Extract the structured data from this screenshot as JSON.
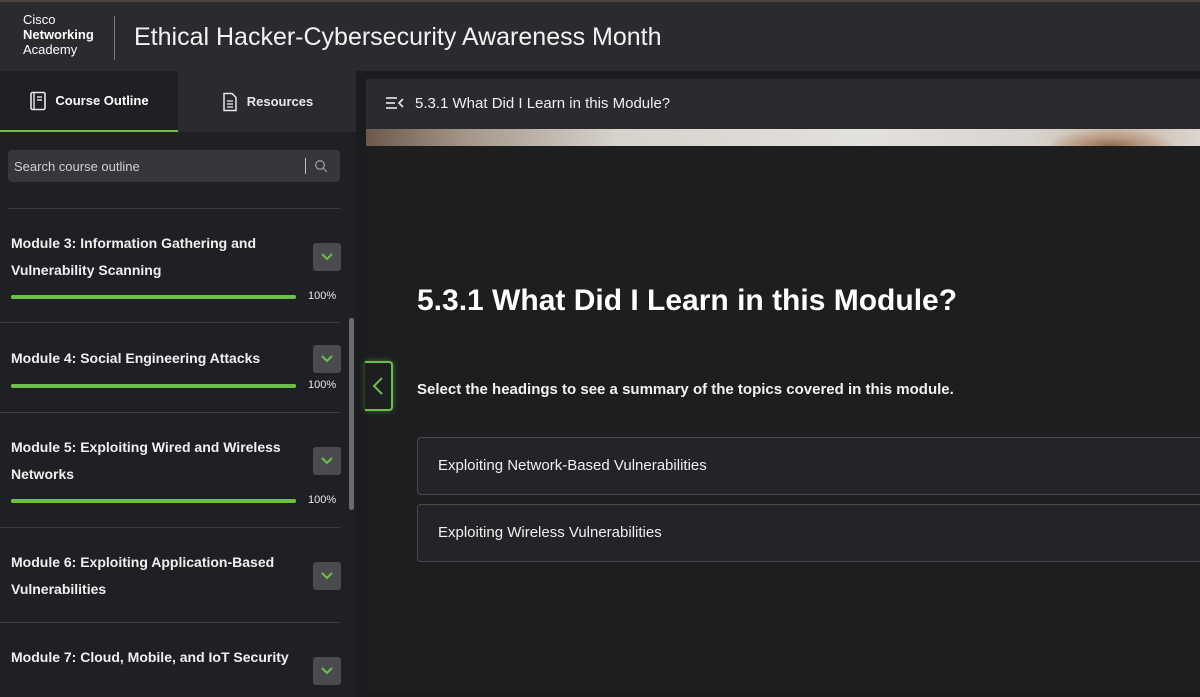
{
  "header": {
    "logo_line1": "Cisco",
    "logo_line2": "Networking",
    "logo_line3": "Academy",
    "course_title": "Ethical Hacker-Cybersecurity Awareness Month"
  },
  "sidebar": {
    "tabs": [
      {
        "label": "Course Outline",
        "icon": "book-icon",
        "active": true
      },
      {
        "label": "Resources",
        "icon": "document-icon",
        "active": false
      }
    ],
    "search": {
      "placeholder": "Search course outline"
    },
    "modules": [
      {
        "title": "Module 3: Information Gathering and Vulnerability Scanning",
        "progress": 100,
        "progress_label": "100%"
      },
      {
        "title": "Module 4: Social Engineering Attacks",
        "progress": 100,
        "progress_label": "100%"
      },
      {
        "title": "Module 5: Exploiting Wired and Wireless Networks",
        "progress": 100,
        "progress_label": "100%"
      },
      {
        "title": "Module 6: Exploiting Application-Based Vulnerabilities"
      },
      {
        "title": "Module 7: Cloud, Mobile, and IoT Security"
      }
    ]
  },
  "main": {
    "bar_title": "5.3.1 What Did I Learn in this Module?",
    "heading": "5.3.1 What Did I Learn in this Module?",
    "intro": "Select the headings to see a summary of the topics covered in this module.",
    "accordions": [
      {
        "label": "Exploiting Network-Based Vulnerabilities"
      },
      {
        "label": "Exploiting Wireless Vulnerabilities"
      }
    ]
  },
  "colors": {
    "accent": "#6cc04a",
    "header_bg": "#2a2b2e",
    "sidebar_bg": "#1f2023",
    "main_bg": "#1d1e20"
  }
}
